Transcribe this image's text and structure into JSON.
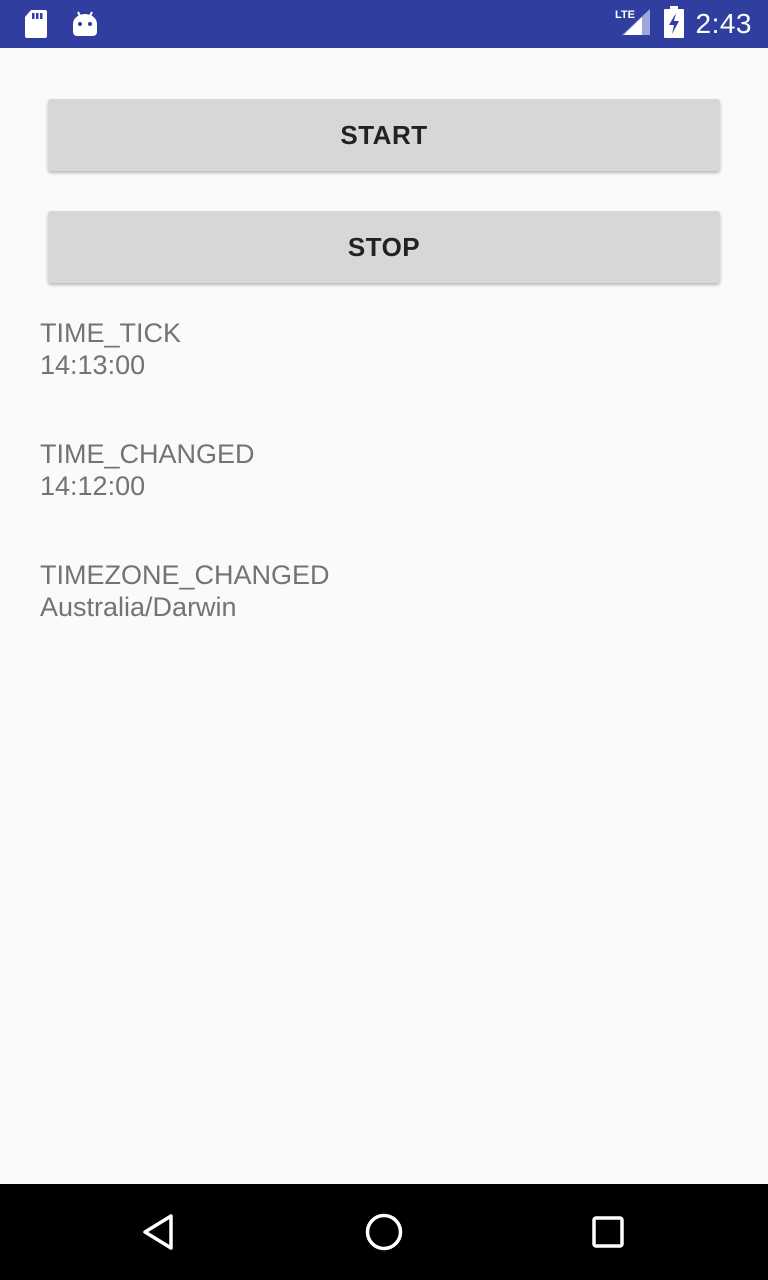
{
  "status_bar": {
    "time": "2:43",
    "network": "LTE",
    "icons": [
      "sd-card-icon",
      "android-icon",
      "lte-signal-icon",
      "battery-charging-icon"
    ]
  },
  "buttons": {
    "start_label": "START",
    "stop_label": "STOP"
  },
  "events": {
    "time_tick": {
      "label": "TIME_TICK",
      "value": "14:13:00"
    },
    "time_changed": {
      "label": "TIME_CHANGED",
      "value": "14:12:00"
    },
    "timezone_changed": {
      "label": "TIMEZONE_CHANGED",
      "value": "Australia/Darwin"
    }
  },
  "nav_bar": {
    "icons": [
      "back-icon",
      "home-icon",
      "recents-icon"
    ]
  },
  "colors": {
    "status_bar": "#303f9f",
    "background": "#fafafa",
    "button": "#d6d7d7",
    "text_secondary": "#737373"
  }
}
